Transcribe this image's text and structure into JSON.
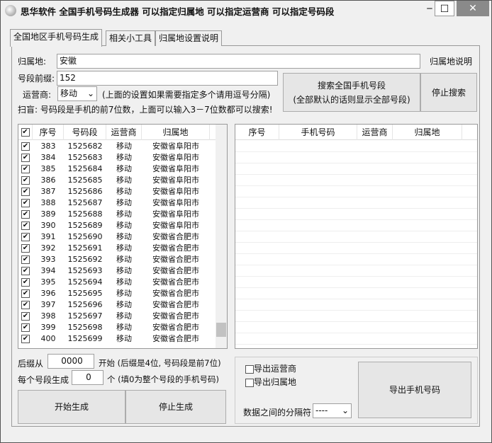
{
  "window": {
    "title": "思华软件  全国手机号码生成器  可以指定归属地  可以指定运营商  可以指定号码段",
    "minimize": "‒",
    "maximize": "☐",
    "close": "✕"
  },
  "tabs": [
    {
      "label": "全国地区手机号码生成"
    },
    {
      "label": "相关小工具"
    },
    {
      "label": "归属地设置说明"
    }
  ],
  "form": {
    "location_label": "归属地:",
    "location_value": "安徽",
    "location_help": "归属地说明",
    "prefix_label": "号段前缀:",
    "prefix_value": "152",
    "carrier_label": "运营商:",
    "carrier_value": "移动",
    "carrier_hint": "(上面的设置如果需要指定多个请用逗号分隔)",
    "tip": "扫盲: 号码段是手机的前7位数，上面可以输入3－7位数都可以搜索!"
  },
  "buttons": {
    "search_line1": "搜索全国手机号段",
    "search_line2": "(全部默认的话则显示全部号段)",
    "stop_search": "停止搜索",
    "start_gen": "开始生成",
    "stop_gen": "停止生成",
    "export": "导出手机号码"
  },
  "left_list": {
    "headers": [
      "序号",
      "号码段",
      "运营商",
      "归属地"
    ],
    "rows": [
      [
        "383",
        "1525682",
        "移动",
        "安徽省阜阳市"
      ],
      [
        "384",
        "1525683",
        "移动",
        "安徽省阜阳市"
      ],
      [
        "385",
        "1525684",
        "移动",
        "安徽省阜阳市"
      ],
      [
        "386",
        "1525685",
        "移动",
        "安徽省阜阳市"
      ],
      [
        "387",
        "1525686",
        "移动",
        "安徽省阜阳市"
      ],
      [
        "388",
        "1525687",
        "移动",
        "安徽省阜阳市"
      ],
      [
        "389",
        "1525688",
        "移动",
        "安徽省阜阳市"
      ],
      [
        "390",
        "1525689",
        "移动",
        "安徽省阜阳市"
      ],
      [
        "391",
        "1525690",
        "移动",
        "安徽省合肥市"
      ],
      [
        "392",
        "1525691",
        "移动",
        "安徽省合肥市"
      ],
      [
        "393",
        "1525692",
        "移动",
        "安徽省合肥市"
      ],
      [
        "394",
        "1525693",
        "移动",
        "安徽省合肥市"
      ],
      [
        "395",
        "1525694",
        "移动",
        "安徽省合肥市"
      ],
      [
        "396",
        "1525695",
        "移动",
        "安徽省合肥市"
      ],
      [
        "397",
        "1525696",
        "移动",
        "安徽省合肥市"
      ],
      [
        "398",
        "1525697",
        "移动",
        "安徽省合肥市"
      ],
      [
        "399",
        "1525698",
        "移动",
        "安徽省合肥市"
      ],
      [
        "400",
        "1525699",
        "移动",
        "安徽省合肥市"
      ]
    ]
  },
  "right_list": {
    "headers": [
      "序号",
      "手机号码",
      "运营商",
      "归属地"
    ]
  },
  "gen": {
    "suffix_label": "后缀从",
    "suffix_value": "0000",
    "suffix_hint": "开始 (后缀是4位, 号码段是前7位)",
    "count_label": "每个号段生成",
    "count_value": "0",
    "count_hint": "个 (填0为整个号段的手机号码)"
  },
  "export": {
    "carrier_opt": "导出运营商",
    "location_opt": "导出归属地",
    "sep_label": "数据之间的分隔符",
    "sep_value": "----"
  }
}
